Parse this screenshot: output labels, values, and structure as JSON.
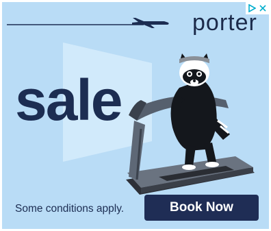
{
  "brand": {
    "name": "porter"
  },
  "headline": "sale",
  "footer": {
    "conditions_text": "Some conditions apply.",
    "cta_label": "Book Now"
  },
  "adchoices": {
    "icons": [
      "adchoices-play-icon",
      "close-icon"
    ]
  },
  "colors": {
    "background": "#b9dcf6",
    "navy": "#1c2d52",
    "button": "#1f2d55",
    "window": "#d4ebfc"
  }
}
